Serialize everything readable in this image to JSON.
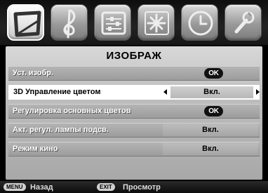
{
  "tabs": [
    {
      "icon": "picture-icon",
      "active": true
    },
    {
      "icon": "sound-icon",
      "active": false
    },
    {
      "icon": "preferences-icon",
      "active": false
    },
    {
      "icon": "setup-icon",
      "active": false
    },
    {
      "icon": "timer-icon",
      "active": false
    },
    {
      "icon": "tools-icon",
      "active": false
    }
  ],
  "panel": {
    "title": "ИЗОБРАЖ"
  },
  "rows": [
    {
      "label": "Уст. изобр.",
      "action": "OK"
    },
    {
      "label": "3D Управление цветом",
      "value": "Вкл."
    },
    {
      "label": "Регулировка основных цветов",
      "action": "OK"
    },
    {
      "label": "Акт. регул. лампы подсв.",
      "value": "Вкл."
    },
    {
      "label": "Режим кино",
      "value": "Вкл."
    }
  ],
  "footer": {
    "menu_key": "MENU",
    "menu_text": "Назад",
    "exit_key": "EXIT",
    "exit_text": "Просмотр"
  },
  "colors": {
    "panel": "#bdbdbd",
    "selected_row": "#ffffff",
    "background": "#000000"
  }
}
